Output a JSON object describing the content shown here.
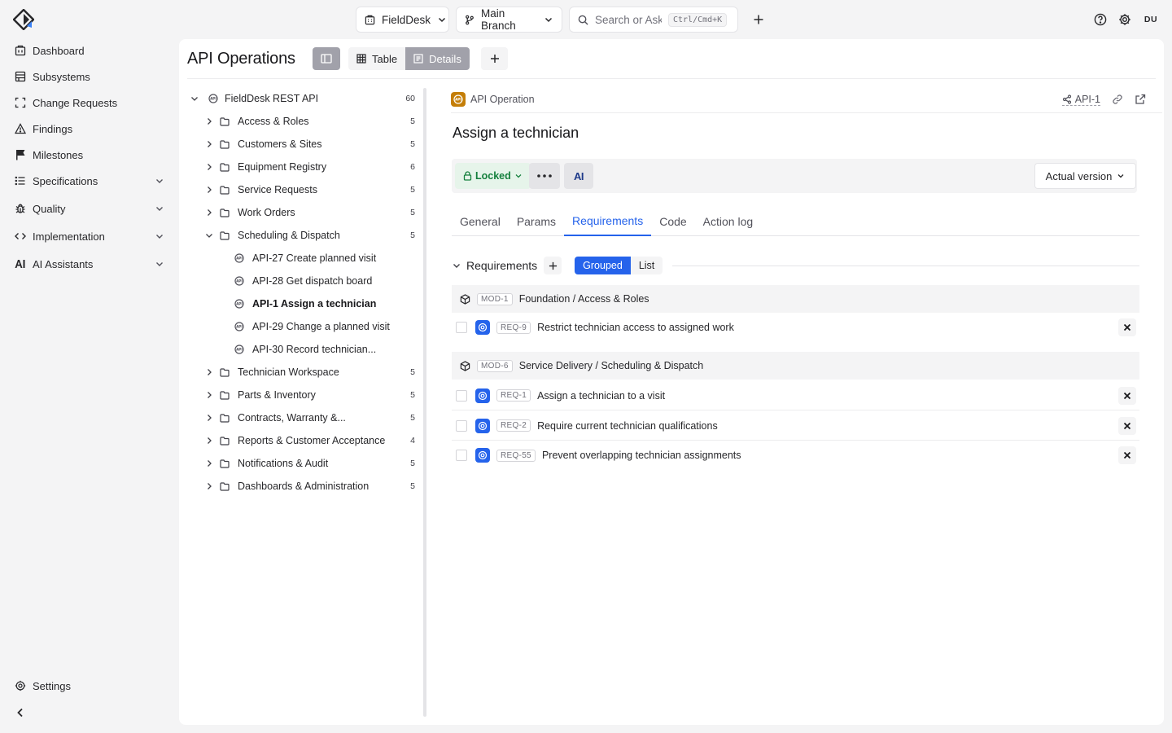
{
  "topbar": {
    "project": "FieldDesk",
    "branch": "Main Branch",
    "search_placeholder": "Search or Ask",
    "search_shortcut": "Ctrl/Cmd+K",
    "user_initials": "DU"
  },
  "sidebar": {
    "items": [
      {
        "label": "Dashboard",
        "icon": "dashboard-icon"
      },
      {
        "label": "Subsystems",
        "icon": "subsystems-icon"
      },
      {
        "label": "Change Requests",
        "icon": "change-requests-icon"
      },
      {
        "label": "Findings",
        "icon": "findings-icon"
      },
      {
        "label": "Milestones",
        "icon": "flag-icon"
      },
      {
        "label": "Specifications",
        "icon": "list-icon"
      },
      {
        "label": "Quality",
        "icon": "bug-icon"
      },
      {
        "label": "Implementation",
        "icon": "code-icon"
      },
      {
        "label": "AI Assistants",
        "icon": "ai-icon"
      }
    ],
    "settings_label": "Settings"
  },
  "main": {
    "title": "API Operations",
    "view_tabs": [
      "Table",
      "Details"
    ],
    "active_view": "Details"
  },
  "tree": {
    "root": {
      "label": "FieldDesk REST API",
      "count": "60"
    },
    "folders": [
      {
        "label": "Access & Roles",
        "count": "5"
      },
      {
        "label": "Customers & Sites",
        "count": "5"
      },
      {
        "label": "Equipment Registry",
        "count": "6"
      },
      {
        "label": "Service Requests",
        "count": "5"
      },
      {
        "label": "Work Orders",
        "count": "5"
      },
      {
        "label": "Scheduling & Dispatch",
        "count": "5"
      },
      {
        "label": "Technician Workspace",
        "count": "5"
      },
      {
        "label": "Parts & Inventory",
        "count": "5"
      },
      {
        "label": "Contracts, Warranty &...",
        "count": "5"
      },
      {
        "label": "Reports & Customer Acceptance",
        "count": "4"
      },
      {
        "label": "Notifications & Audit",
        "count": "5"
      },
      {
        "label": "Dashboards & Administration",
        "count": "5"
      }
    ],
    "operations": [
      {
        "label": "API-27 Create planned visit"
      },
      {
        "label": "API-28 Get dispatch board"
      },
      {
        "label": "API-1 Assign a technician"
      },
      {
        "label": "API-29 Change a planned visit"
      },
      {
        "label": "API-30 Record technician..."
      }
    ]
  },
  "detail": {
    "type_label": "API Operation",
    "id": "API-1",
    "title": "Assign a technician",
    "status": "Locked",
    "ai_label": "AI",
    "version": "Actual version",
    "tabs": [
      "General",
      "Params",
      "Requirements",
      "Code",
      "Action log"
    ],
    "active_tab": "Requirements",
    "requirements": {
      "header": "Requirements",
      "modes": [
        "Grouped",
        "List"
      ],
      "active_mode": "Grouped",
      "groups": [
        {
          "chip": "MOD-1",
          "path": "Foundation / Access & Roles",
          "items": [
            {
              "chip": "REQ-9",
              "title": "Restrict technician access to assigned work"
            }
          ]
        },
        {
          "chip": "MOD-6",
          "path": "Service Delivery / Scheduling & Dispatch",
          "items": [
            {
              "chip": "REQ-1",
              "title": "Assign a technician to a visit"
            },
            {
              "chip": "REQ-2",
              "title": "Require current technician qualifications"
            },
            {
              "chip": "REQ-55",
              "title": "Prevent overlapping technician assignments"
            }
          ]
        }
      ]
    }
  },
  "colors": {
    "accent": "#2563eb",
    "locked_bg": "#e6f4ea",
    "locked_text": "#15803d",
    "api_badge": "#c47e08"
  }
}
